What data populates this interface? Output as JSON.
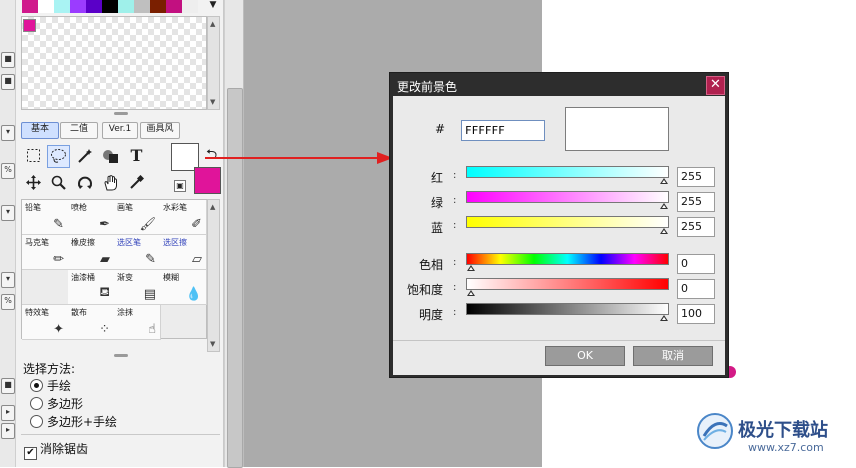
{
  "colors": {
    "accent": "#e0149a",
    "swatches": [
      "#d01a8c",
      "#ffffff",
      "#a9f3f3",
      "#9b3cff",
      "#5a00c8",
      "#000000",
      "#9ff0ea",
      "#bfbfbf",
      "#7a1f00",
      "#c21080",
      "#eeeeee"
    ],
    "foreground": "#ffffff",
    "background": "#e0149a"
  },
  "tool_panel": {
    "tabs": [
      {
        "label": "基本",
        "active": true
      },
      {
        "label": "二值",
        "active": false
      },
      {
        "label": "Ver.1",
        "active": false
      },
      {
        "label": "画具风",
        "active": false
      }
    ],
    "tools": [
      "lasso-select-icon",
      "magic-wand-icon",
      "fill-icon",
      "text-icon",
      "move-icon",
      "zoom-icon",
      "rotate-icon",
      "hand-icon",
      "eyedropper-icon"
    ],
    "text_tool_glyph": "T",
    "brushes": [
      {
        "label": "铅笔",
        "icon": "pencil-icon",
        "blue": false
      },
      {
        "label": "喷枪",
        "icon": "airbrush-icon",
        "blue": false
      },
      {
        "label": "画笔",
        "icon": "brush-icon",
        "blue": false
      },
      {
        "label": "水彩笔",
        "icon": "watercolor-icon",
        "blue": false
      },
      {
        "label": "马克笔",
        "icon": "marker-icon",
        "blue": false
      },
      {
        "label": "橡皮擦",
        "icon": "eraser-icon",
        "blue": false
      },
      {
        "label": "选区笔",
        "icon": "selection-pen-icon",
        "blue": true
      },
      {
        "label": "选区擦",
        "icon": "selection-eraser-icon",
        "blue": true
      },
      {
        "label": "",
        "icon": "",
        "blue": false
      },
      {
        "label": "油漆桶",
        "icon": "bucket-icon",
        "blue": false
      },
      {
        "label": "渐变",
        "icon": "gradient-icon",
        "blue": false
      },
      {
        "label": "模糊",
        "icon": "blur-icon",
        "blue": false
      },
      {
        "label": "特效笔",
        "icon": "effect-pen-icon",
        "blue": false
      },
      {
        "label": "散布",
        "icon": "scatter-icon",
        "blue": false
      },
      {
        "label": "涂抹",
        "icon": "smudge-icon",
        "blue": false
      }
    ],
    "select_method": {
      "title": "选择方法:",
      "options": [
        {
          "label": "手绘",
          "selected": true
        },
        {
          "label": "多边形",
          "selected": false
        },
        {
          "label": "多边形+手绘",
          "selected": false
        }
      ]
    },
    "antialias": {
      "label": "消除锯齿",
      "checked": true
    }
  },
  "dialog": {
    "title": "更改前景色",
    "hex_label": "#",
    "hex_value": "FFFFFF",
    "preview_color": "#ffffff",
    "sliders": [
      {
        "label": "红",
        "value": "255",
        "fraction": 1.0
      },
      {
        "label": "绿",
        "value": "255",
        "fraction": 1.0
      },
      {
        "label": "蓝",
        "value": "255",
        "fraction": 1.0
      },
      {
        "label": "色相",
        "value": "0",
        "fraction": 0.0
      },
      {
        "label": "饱和度",
        "value": "0",
        "fraction": 0.0
      },
      {
        "label": "明度",
        "value": "100",
        "fraction": 1.0
      }
    ],
    "ok_label": "OK",
    "cancel_label": "取消"
  },
  "watermark": {
    "text": "极光下载站",
    "url": "www.xz7.com"
  }
}
